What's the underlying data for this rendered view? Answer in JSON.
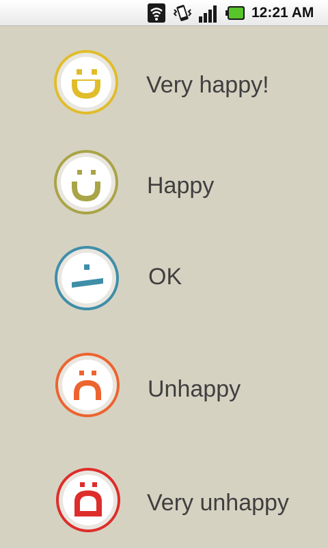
{
  "status_bar": {
    "time": "12:21 AM",
    "icons": [
      "wifi-icon",
      "vibrate-icon",
      "signal-icon",
      "battery-icon"
    ],
    "battery_color": "#58c52a"
  },
  "moods": [
    {
      "label": "Very happy!",
      "icon": "very-happy-face-icon",
      "color": "#e0bd2a"
    },
    {
      "label": "Happy",
      "icon": "happy-face-icon",
      "color": "#a9a447"
    },
    {
      "label": "OK",
      "icon": "ok-face-icon",
      "color": "#3f8ea8"
    },
    {
      "label": "Unhappy",
      "icon": "unhappy-face-icon",
      "color": "#ec6430"
    },
    {
      "label": "Very unhappy",
      "icon": "very-unhappy-face-icon",
      "color": "#dd2e2b"
    }
  ]
}
